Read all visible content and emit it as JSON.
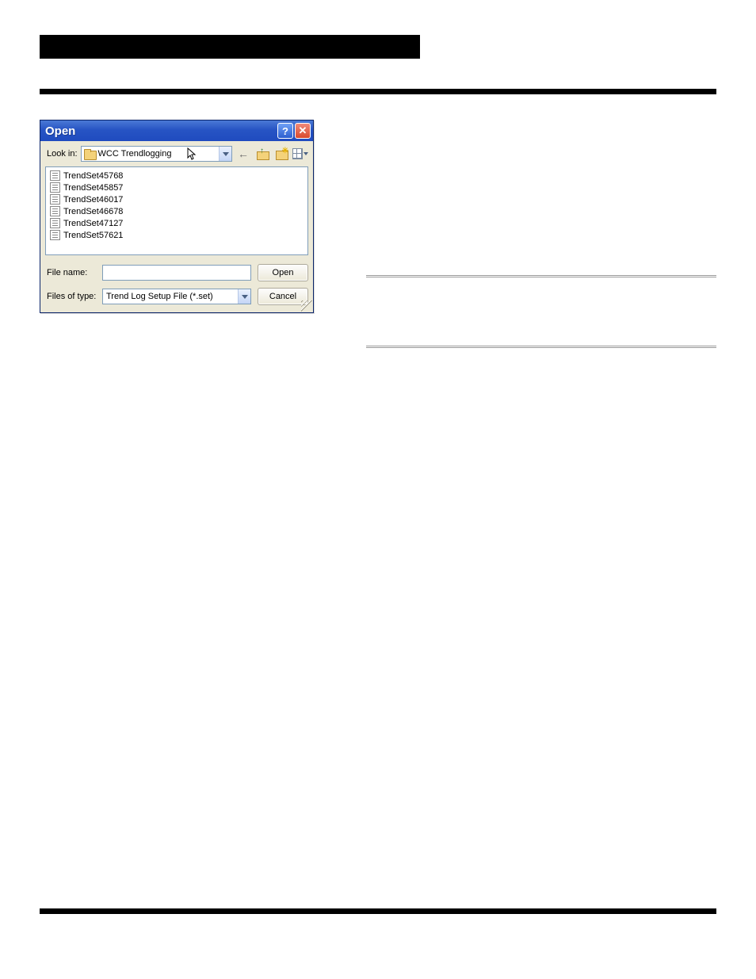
{
  "dialog": {
    "title": "Open",
    "help_tooltip": "?",
    "close_tooltip": "✕",
    "look_in_label": "Look in:",
    "look_in_value": "WCC Trendlogging",
    "files": [
      "TrendSet45768",
      "TrendSet45857",
      "TrendSet46017",
      "TrendSet46678",
      "TrendSet47127",
      "TrendSet57621"
    ],
    "file_name_label": "File name:",
    "file_name_value": "",
    "files_of_type_label": "Files of type:",
    "files_of_type_value": "Trend Log Setup File (*.set)",
    "open_button": "Open",
    "cancel_button": "Cancel"
  }
}
